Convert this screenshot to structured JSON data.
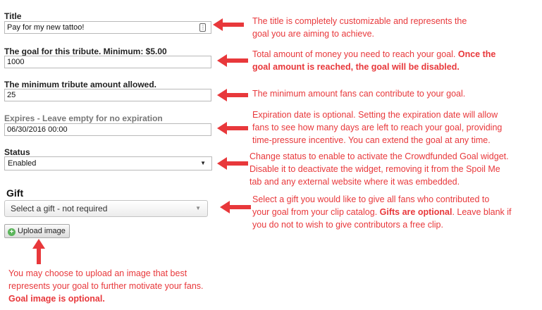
{
  "form": {
    "title": {
      "label": "Title",
      "value": "Pay for my new tattoo!"
    },
    "goal": {
      "label": "The goal for this tribute. Minimum: $5.00",
      "value": "1000"
    },
    "minimum": {
      "label": "The minimum tribute amount allowed.",
      "value": "25"
    },
    "expires": {
      "label": "Expires - Leave empty for no expiration",
      "value": "06/30/2016 00:00"
    },
    "status": {
      "label": "Status",
      "value": "Enabled"
    },
    "gift": {
      "label": "Gift",
      "value": "Select a gift - not required"
    },
    "upload_button": "Upload image"
  },
  "annotations": {
    "title": [
      "The title is completely customizable and represents the",
      "goal you are aiming to achieve."
    ],
    "goal": {
      "line1": "Total amount of money you need to reach your goal. ",
      "line1_bold": "Once the",
      "line2_bold": "goal amount is reached, the goal will be disabled."
    },
    "minimum": "The minimum amount fans can contribute to your goal.",
    "expires": [
      "Expiration date is optional. Setting the expiration date will allow",
      "fans to see how many days are left to reach your goal, providing",
      "time-pressure incentive. You can extend the goal at any time."
    ],
    "status": [
      "Change status to enable to activate the Crowdfunded Goal widget.",
      "Disable it to deactivate the widget, removing it from the Spoil Me",
      "tab and any external website where it was embedded."
    ],
    "gift": {
      "line1": "Select a gift you would like to give all fans who contributed to",
      "line2_pre": "your goal from your clip catalog. ",
      "line2_bold": "Gifts are optional",
      "line2_post": ". Leave blank if",
      "line3": "you do not to wish to give contributors a free clip."
    },
    "upload": {
      "line1": "You may choose to upload an image that best",
      "line2": "represents your goal to further motivate your fans.",
      "line3_bold": "Goal image is optional."
    }
  },
  "colors": {
    "annotation": "#e8383b",
    "arrow": "#e8383b",
    "field_border": "#b9b9b9"
  }
}
